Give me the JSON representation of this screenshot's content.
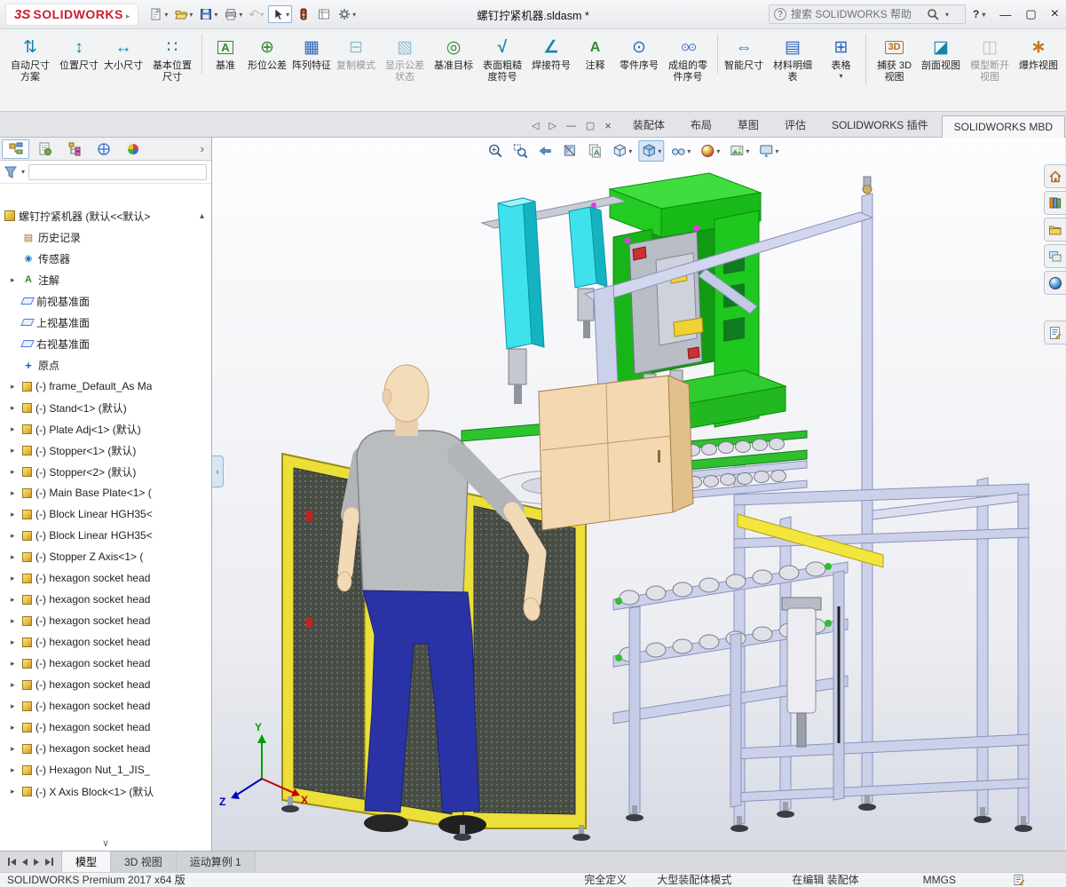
{
  "titlebar": {
    "logo_mark": "3S",
    "logo_text": "SOLIDWORKS",
    "doc_title": "螺钉拧紧机器.sldasm *",
    "search_placeholder": "搜索 SOLIDWORKS 帮助",
    "help_label": "?",
    "quick_tools": [
      "new-document",
      "open",
      "save",
      "print",
      "undo",
      "select",
      "rebuild-stoplight",
      "file-properties",
      "options-gear"
    ],
    "window_controls": [
      "minimize",
      "maximize",
      "close"
    ]
  },
  "ribbon": {
    "buttons": [
      {
        "label": "自动尺寸方案",
        "icon": "ic-autodim",
        "state": "",
        "dd": "",
        "sep": ""
      },
      {
        "label": "位置尺寸",
        "icon": "ic-locdim",
        "state": "",
        "dd": "",
        "sep": ""
      },
      {
        "label": "大小尺寸",
        "icon": "ic-sizedim",
        "state": "",
        "dd": "",
        "sep": ""
      },
      {
        "label": "基本位置尺寸",
        "icon": "ic-basicdim",
        "state": "",
        "dd": "",
        "sep": ""
      },
      {
        "label": "基准",
        "icon": "ic-datum",
        "state": "",
        "dd": "",
        "sep": "sep"
      },
      {
        "label": "形位公差",
        "icon": "ic-geotol",
        "state": "",
        "dd": "",
        "sep": ""
      },
      {
        "label": "阵列特征",
        "icon": "ic-pattern",
        "state": "",
        "dd": "",
        "sep": ""
      },
      {
        "label": "复制模式",
        "icon": "ic-copyscheme",
        "state": "disabled",
        "dd": "",
        "sep": ""
      },
      {
        "label": "显示公差状态",
        "icon": "ic-tolstatus",
        "state": "disabled",
        "dd": "",
        "sep": ""
      },
      {
        "label": "基准目标",
        "icon": "ic-datumtarget",
        "state": "",
        "dd": "",
        "sep": ""
      },
      {
        "label": "表面粗糙度符号",
        "icon": "ic-surface",
        "state": "",
        "dd": "",
        "sep": ""
      },
      {
        "label": "焊接符号",
        "icon": "ic-weld",
        "state": "",
        "dd": "",
        "sep": ""
      },
      {
        "label": "注释",
        "icon": "ic-note",
        "state": "",
        "dd": "",
        "sep": ""
      },
      {
        "label": "零件序号",
        "icon": "ic-balloon",
        "state": "",
        "dd": "",
        "sep": ""
      },
      {
        "label": "成组的零件序号",
        "icon": "ic-autoballoon",
        "state": "",
        "dd": "",
        "sep": ""
      },
      {
        "label": "智能尺寸",
        "icon": "ic-smartdim",
        "state": "",
        "dd": "",
        "sep": "sep"
      },
      {
        "label": "材料明细表",
        "icon": "ic-bom",
        "state": "",
        "dd": "",
        "sep": ""
      },
      {
        "label": "表格",
        "icon": "ic-table",
        "state": "",
        "dd": "dd",
        "sep": ""
      },
      {
        "label": "捕获 3D 视图",
        "icon": "ic-3dview",
        "state": "",
        "dd": "",
        "sep": "sep"
      },
      {
        "label": "剖面视图",
        "icon": "ic-section",
        "state": "",
        "dd": "",
        "sep": ""
      },
      {
        "label": "模型断开视图",
        "icon": "ic-break",
        "state": "disabled",
        "dd": "",
        "sep": ""
      },
      {
        "label": "爆炸视图",
        "icon": "ic-explode",
        "state": "",
        "dd": "",
        "sep": ""
      }
    ]
  },
  "command_tabs": {
    "tabs": [
      {
        "label": "装配体",
        "cls": ""
      },
      {
        "label": "布局",
        "cls": ""
      },
      {
        "label": "草图",
        "cls": ""
      },
      {
        "label": "评估",
        "cls": ""
      },
      {
        "label": "SOLIDWORKS 插件",
        "cls": ""
      },
      {
        "label": "SOLIDWORKS MBD",
        "cls": "active"
      }
    ],
    "doc_window_controls": [
      "previous-pane",
      "next-pane",
      "minimize-doc",
      "restore-doc",
      "close-doc"
    ]
  },
  "feature_tree": {
    "header_tabs": [
      "featuremanager-tree",
      "propertymanager",
      "configurationmanager",
      "dimxpertmanager",
      "displaymanager"
    ],
    "root_label": "螺钉拧紧机器 (默认<<默认>",
    "items": [
      {
        "label": "历史记录",
        "icon": "history-icon",
        "arrow": ""
      },
      {
        "label": "传感器",
        "icon": "sensors-icon",
        "arrow": ""
      },
      {
        "label": "注解",
        "icon": "annotations-icon",
        "arrow": "has-arrow"
      },
      {
        "label": "前视基准面",
        "icon": "plane-icon",
        "arrow": ""
      },
      {
        "label": "上视基准面",
        "icon": "plane-icon",
        "arrow": ""
      },
      {
        "label": "右视基准面",
        "icon": "plane-icon",
        "arrow": ""
      },
      {
        "label": "原点",
        "icon": "origin-icon",
        "arrow": ""
      },
      {
        "label": "(-) frame_Default_As Ma",
        "icon": "component-icon",
        "arrow": "has-arrow"
      },
      {
        "label": "(-) Stand<1> (默认)",
        "icon": "component-icon",
        "arrow": "has-arrow"
      },
      {
        "label": "(-) Plate Adj<1> (默认)",
        "icon": "component-icon",
        "arrow": "has-arrow"
      },
      {
        "label": "(-) Stopper<1> (默认)",
        "icon": "component-icon",
        "arrow": "has-arrow"
      },
      {
        "label": "(-) Stopper<2> (默认)",
        "icon": "component-icon",
        "arrow": "has-arrow"
      },
      {
        "label": "(-) Main Base Plate<1> (",
        "icon": "component-icon",
        "arrow": "has-arrow"
      },
      {
        "label": "(-) Block Linear HGH35<",
        "icon": "component-icon",
        "arrow": "has-arrow"
      },
      {
        "label": "(-) Block Linear HGH35<",
        "icon": "component-icon",
        "arrow": "has-arrow"
      },
      {
        "label": "(-) Stopper Z Axis<1> (",
        "icon": "component-icon",
        "arrow": "has-arrow"
      },
      {
        "label": "(-) hexagon socket head",
        "icon": "component-icon",
        "arrow": "has-arrow"
      },
      {
        "label": "(-) hexagon socket head",
        "icon": "component-icon",
        "arrow": "has-arrow"
      },
      {
        "label": "(-) hexagon socket head",
        "icon": "component-icon",
        "arrow": "has-arrow"
      },
      {
        "label": "(-) hexagon socket head",
        "icon": "component-icon",
        "arrow": "has-arrow"
      },
      {
        "label": "(-) hexagon socket head",
        "icon": "component-icon",
        "arrow": "has-arrow"
      },
      {
        "label": "(-) hexagon socket head",
        "icon": "component-icon",
        "arrow": "has-arrow"
      },
      {
        "label": "(-) hexagon socket head",
        "icon": "component-icon",
        "arrow": "has-arrow"
      },
      {
        "label": "(-) hexagon socket head",
        "icon": "component-icon",
        "arrow": "has-arrow"
      },
      {
        "label": "(-) hexagon socket head",
        "icon": "component-icon",
        "arrow": "has-arrow"
      },
      {
        "label": "(-) Hexagon Nut_1_JIS_",
        "icon": "component-icon",
        "arrow": "has-arrow"
      },
      {
        "label": "(-) X Axis Block<1> (默认",
        "icon": "component-icon",
        "arrow": "has-arrow"
      }
    ]
  },
  "hud": {
    "buttons": [
      "zoom-to-fit",
      "zoom-to-area",
      "previous-view",
      "section-view",
      "dynamic-annotation-views",
      "display-style",
      "view-orientation",
      "hide-show-items",
      "edit-appearance",
      "apply-scene",
      "view-settings"
    ]
  },
  "task_pane": {
    "icons": [
      "solidworks-resources-home",
      "design-library",
      "file-explorer",
      "view-palette",
      "appearances",
      "custom-properties"
    ]
  },
  "scene": {
    "triad": {
      "x": "X",
      "y": "Y",
      "z": "Z"
    },
    "colors": {
      "machine_green": "#1ec81e",
      "spindle_cyan": "#3fe2ec",
      "fence_yellow": "#ecdf39",
      "frame_lavender": "#ccd1ea",
      "cabinet_tan": "#f3d8b2",
      "mannequin_shirt": "#babdbf",
      "mannequin_pants": "#2a33a6"
    }
  },
  "bottom_tabs": {
    "tabs": [
      {
        "label": "模型",
        "cls": "active"
      },
      {
        "label": "3D 视图",
        "cls": ""
      },
      {
        "label": "运动算例 1",
        "cls": ""
      }
    ]
  },
  "statusbar": {
    "left": "SOLIDWORKS Premium 2017 x64 版",
    "items": [
      "完全定义",
      "大型装配体模式",
      "在编辑 装配体",
      "MMGS"
    ]
  }
}
